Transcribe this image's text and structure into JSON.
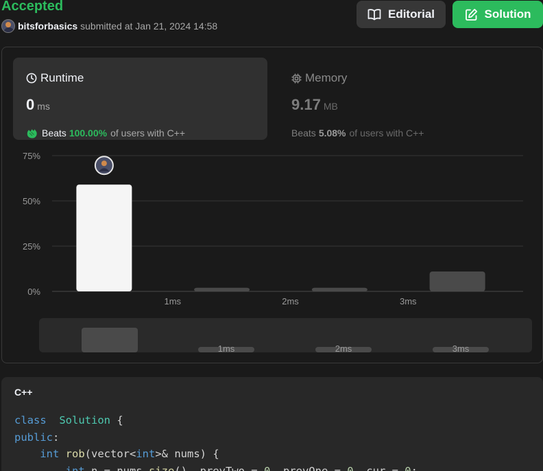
{
  "header": {
    "status": "Accepted",
    "username": "bitsforbasics",
    "submitted_text": "submitted at Jan 21, 2024 14:58",
    "editorial_label": "Editorial",
    "solution_label": "Solution"
  },
  "runtime": {
    "title": "Runtime",
    "value": "0",
    "unit": "ms",
    "beats_label": "Beats",
    "beats_pct": "100.00%",
    "beats_suffix": "of users with C++"
  },
  "memory": {
    "title": "Memory",
    "value": "9.17",
    "unit": "MB",
    "beats_label": "Beats",
    "beats_pct": "5.08%",
    "beats_suffix": "of users with C++"
  },
  "chart_data": {
    "type": "bar",
    "categories": [
      "",
      "1ms",
      "2ms",
      "3ms"
    ],
    "values": [
      59,
      2,
      2,
      11
    ],
    "yticks": [
      "0%",
      "25%",
      "50%",
      "75%"
    ],
    "ylim": [
      0,
      75
    ],
    "highlight_index": 0,
    "grid": true,
    "overview": {
      "categories": [
        "",
        "1ms",
        "2ms",
        "3ms"
      ]
    }
  },
  "code": {
    "language": "C++",
    "lines": [
      [
        [
          "kw",
          "class"
        ],
        [
          "",
          "  "
        ],
        [
          "ty",
          "Solution"
        ],
        [
          "",
          " {"
        ]
      ],
      [
        [
          "kw",
          "public"
        ],
        [
          "",
          ":"
        ]
      ],
      [
        [
          "",
          "    "
        ],
        [
          "kw",
          "int"
        ],
        [
          "",
          " "
        ],
        [
          "fn",
          "rob"
        ],
        [
          "",
          "(vector<"
        ],
        [
          "kw",
          "int"
        ],
        [
          "",
          ">& nums) {"
        ]
      ],
      [
        [
          "",
          "        "
        ],
        [
          "kw",
          "int"
        ],
        [
          "",
          " n = nums."
        ],
        [
          "fn",
          "size"
        ],
        [
          "",
          "(), prevTwo = "
        ],
        [
          "num",
          "0"
        ],
        [
          "",
          ", prevOne = "
        ],
        [
          "num",
          "0"
        ],
        [
          "",
          ", cur = "
        ],
        [
          "num",
          "0"
        ],
        [
          "",
          ";"
        ]
      ]
    ]
  },
  "colors": {
    "accent_green": "#2cbb5d",
    "bar_highlight": "#f5f5f5",
    "bar_default": "#4a4a4a"
  }
}
